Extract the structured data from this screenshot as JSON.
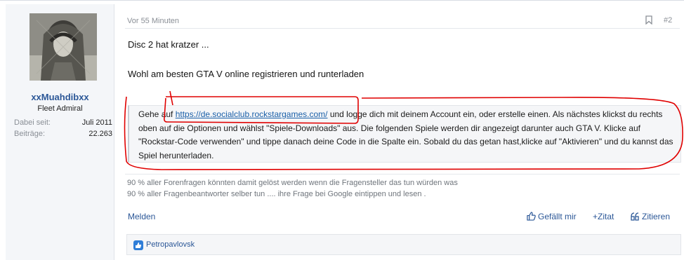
{
  "user": {
    "name": "xxMuahdibxx",
    "title": "Fleet Admiral",
    "stats": [
      {
        "label": "Dabei seit:",
        "value": "Juli 2011"
      },
      {
        "label": "Beiträge:",
        "value": "22.263"
      }
    ]
  },
  "post": {
    "time": "Vor 55 Minuten",
    "number": "#2",
    "line1": "Disc 2 hat kratzer ...",
    "line2": "Wohl am besten GTA V online registrieren und runterladen",
    "quote": {
      "prefix": "Gehe auf ",
      "link": "https://de.socialclub.rockstargames.com/",
      "text": " und logge dich mit deinem Account ein, oder erstelle einen. Als nächstes klickst du rechts oben auf die Optionen und wählst \"Spiele-Downloads\" aus. Die folgenden Spiele werden dir angezeigt darunter auch GTA V. Klicke auf \"Rockstar-Code verwenden\" und tippe danach deine Code in die Spalte ein. Sobald du das getan hast,klicke auf \"Aktivieren\" und du kannst das Spiel herunterladen."
    },
    "signature": [
      "90 % aller Forenfragen könnten damit gelöst werden wenn die Fragensteller das tun würden was",
      "90 % aller Fragenbeantworter selber tun .... ihre Frage bei Google eintippen und lesen ."
    ]
  },
  "actions": {
    "report": "Melden",
    "like": "Gefällt mir",
    "quote": "+Zitat",
    "quote_multi": "Zitieren"
  },
  "reactions": {
    "user": "Petropavlovsk"
  },
  "colors": {
    "link": "#2b5797",
    "annotation": "#e00000"
  }
}
